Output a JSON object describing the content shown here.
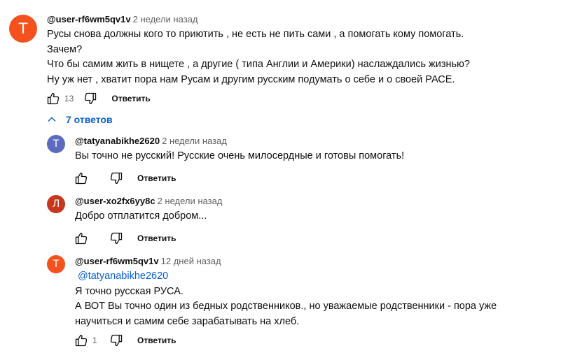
{
  "main_comment": {
    "avatar_letter": "Т",
    "avatar_color": "#f4511e",
    "author": "@user-rf6wm5qv1v",
    "time": "2 недели назад",
    "lines": [
      "Русы снова должны кого то приютить , не есть не пить сами , а помогать  кому помогать.",
      "Зачем?",
      "Что бы самим жить в нищете , а другие ( типа Англии и Америки) наслаждались жизнью?",
      "Ну уж нет , хватит пора нам Русам и другим русским подумать о себе и о своей РАСЕ."
    ],
    "likes": "13",
    "reply_label": "Ответить"
  },
  "replies_toggle": {
    "label": "7 ответов",
    "icon": "chevron-up-icon"
  },
  "replies": [
    {
      "avatar_letter": "Т",
      "avatar_color": "#5c6bc0",
      "author": "@tatyanabikhe2620",
      "time": "2 недели назад",
      "lines": [
        "Вы точно не русский!  Русские очень милосердные и готовы помогать!"
      ],
      "likes": "",
      "reply_label": "Ответить"
    },
    {
      "avatar_letter": "Л",
      "avatar_color": "#c5381f",
      "author": "@user-xo2fx6yy8c",
      "time": "2 недели назад",
      "lines": [
        "Добро отплатится  добром..."
      ],
      "likes": "",
      "reply_label": "Ответить"
    },
    {
      "avatar_letter": "Т",
      "avatar_color": "#f4511e",
      "author": "@user-rf6wm5qv1v",
      "time": "12 дней назад",
      "mention": "@tatyanabikhe2620",
      "lines": [
        "Я точно русская РУСА.",
        "А ВОТ Вы точно один из бедных родственников., но уважаемые родственники - пора уже",
        "научиться и самим себе  зарабатывать на хлеб."
      ],
      "likes": "1",
      "reply_label": "Ответить"
    }
  ]
}
